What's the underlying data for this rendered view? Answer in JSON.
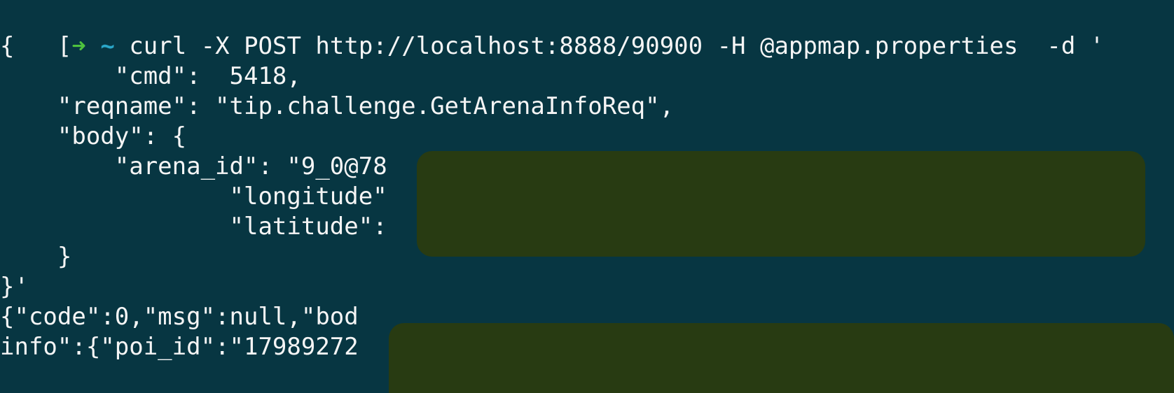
{
  "terminal": {
    "prompt": {
      "bracket": "[",
      "arrow": "➜",
      "cwd": "~",
      "command": "curl -X POST http://localhost:8888/90900 -H @appmap.properties  -d '"
    },
    "lines": [
      "{",
      "        \"cmd\":  5418,",
      "    \"reqname\": \"tip.challenge.GetArenaInfoReq\",",
      "    \"body\": {",
      "        \"arena_id\": \"9_0@78",
      "                \"longitude\"",
      "                \"latitude\":",
      "    }",
      "}'",
      "{\"code\":0,\"msg\":null,\"bod",
      "info\":{\"poi_id\":\"17989272"
    ]
  },
  "colors": {
    "background": "#073642",
    "text": "#f5f5f5",
    "prompt_arrow": "#4ec23e",
    "prompt_cwd": "#2aa6c8",
    "redaction": "#283b12"
  }
}
